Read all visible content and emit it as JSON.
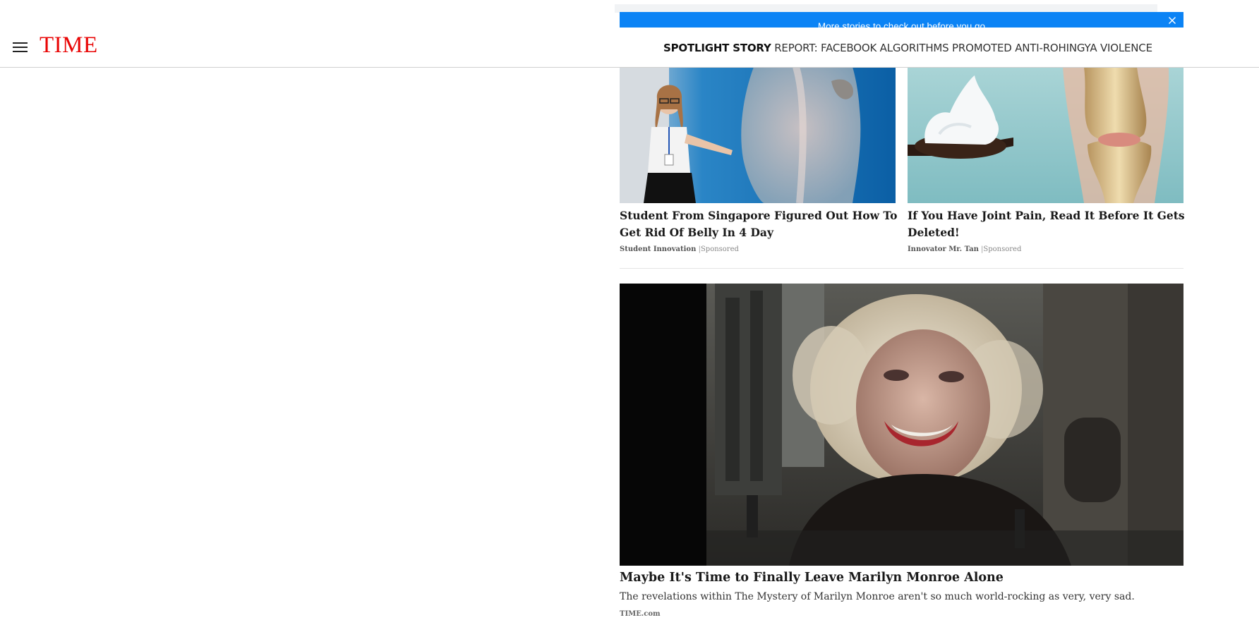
{
  "header": {
    "logo": "TIME",
    "menu_icon": "hamburger-menu-icon",
    "spotlight_label": "SPOTLIGHT STORY",
    "spotlight_text": "REPORT: FACEBOOK ALGORITHMS PROMOTED ANTI-ROHINGYA VIOLENCE"
  },
  "recirc_bar": {
    "text": "More stories to check out before you go",
    "close_icon": "close-icon",
    "color": "#0b83f5"
  },
  "sponsored": [
    {
      "title": "Student From Singapore Figured Out How To Get Rid Of Belly In 4 Day",
      "source": "Student Innovation",
      "label": "Sponsored"
    },
    {
      "title": "If You Have Joint Pain, Read It Before It Gets Deleted!",
      "source": "Innovator Mr. Tan",
      "label": "Sponsored"
    }
  ],
  "feature": {
    "title": "Maybe It's Time to Finally Leave Marilyn Monroe Alone",
    "description": "The revelations within The Mystery of Marilyn Monroe aren't so much world-rocking as very, very sad.",
    "source": "TIME.com"
  },
  "colors": {
    "logo": "#e90606",
    "accent_blue": "#0b83f5"
  }
}
